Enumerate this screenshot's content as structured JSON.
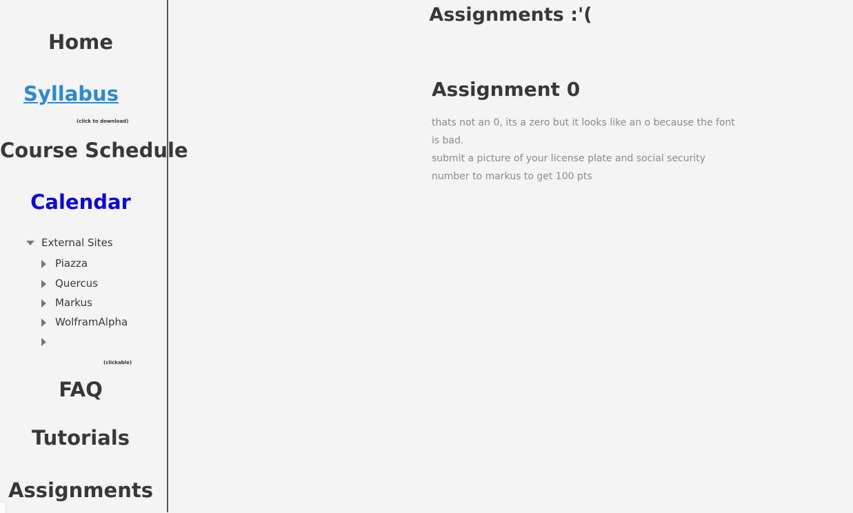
{
  "sidebar": {
    "home": "Home",
    "syllabus": "Syllabus",
    "syllabus_note": "(click to download)",
    "course_schedule": "Course Schedule",
    "calendar": "Calendar",
    "external_sites": {
      "label": "External Sites",
      "items": [
        "Piazza",
        "Quercus",
        "Markus",
        "WolframAlpha",
        ""
      ]
    },
    "clickable_note": "(clickable)",
    "faq": "FAQ",
    "tutorials": "Tutorials",
    "assignments": "Assignments"
  },
  "main": {
    "title": "Assignments :'(",
    "assignment": {
      "heading": "Assignment 0",
      "paragraphs": [
        "thats not an 0, its a zero but it looks like an o because the font is bad.",
        "submit a picture of your license plate and social security number to markus to get 100 pts"
      ]
    }
  },
  "colors": {
    "background": "#f4f4f4",
    "text": "#383838",
    "syllabus_link": "#2a8ad8",
    "calendar_link": "#0a07e4",
    "body_text": "#8a8a8a",
    "sidebar_border": "#555555"
  }
}
